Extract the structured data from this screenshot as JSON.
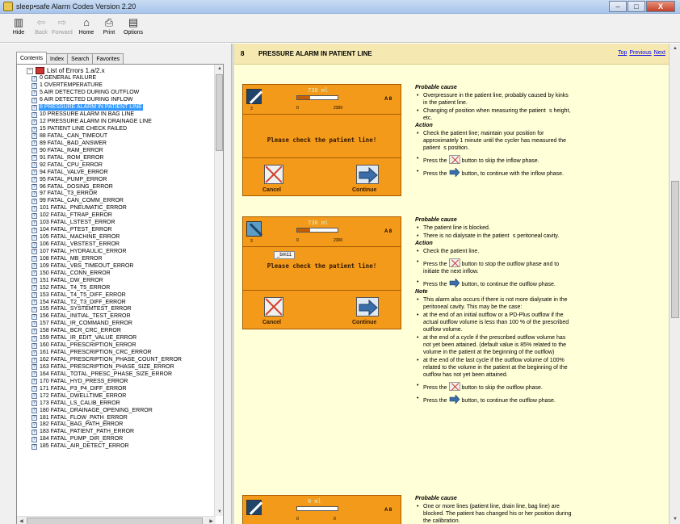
{
  "window": {
    "title": "sleep•safe Alarm Codes Version 2.20",
    "controls": [
      "–",
      "□",
      "X"
    ]
  },
  "toolbar": [
    {
      "name": "hide",
      "label": "Hide",
      "icon": "hide-icon",
      "glyph": "▥",
      "enabled": true
    },
    {
      "name": "back",
      "label": "Back",
      "icon": "back-arrow-icon",
      "glyph": "⇦",
      "enabled": false
    },
    {
      "name": "forward",
      "label": "Forward",
      "icon": "forward-arrow-icon",
      "glyph": "⇨",
      "enabled": false
    },
    {
      "name": "home",
      "label": "Home",
      "icon": "home-icon",
      "glyph": "⌂",
      "enabled": true
    },
    {
      "name": "print",
      "label": "Print",
      "icon": "printer-icon",
      "glyph": "⎙",
      "enabled": true
    },
    {
      "name": "options",
      "label": "Options",
      "icon": "options-icon",
      "glyph": "▤",
      "enabled": true
    }
  ],
  "nav": {
    "tabs": [
      "Contents",
      "Index",
      "Search",
      "Favorites"
    ],
    "active_tab": "Contents",
    "root": "List of Errors 1.a/2.x",
    "items": [
      "0 GENERAL FAILURE",
      "1 OVERTEMPERATURE",
      "5 AIR DETECTED DURING OUTFLOW",
      "6 AIR DETECTED DURING INFLOW",
      "8 PRESSURE ALARM IN PATIENT LINE",
      "10 PRESSURE ALARM IN BAG LINE",
      "12 PRESSURE ALARM IN DRAINAGE LINE",
      "15 PATIENT LINE CHECK FAILED",
      "88 FATAL_CAN_TIMEOUT",
      "89 FATAL_BAD_ANSWER",
      "90 FATAL_RAM_ERROR",
      "91 FATAL_ROM_ERROR",
      "92 FATAL_CPU_ERROR",
      "94 FATAL_VALVE_ERROR",
      "95 FATAL_PUMP_ERROR",
      "96 FATAL_DOSING_ERROR",
      "97 FATAL_T3_ERROR",
      "99 FATAL_CAN_COMM_ERROR",
      "101 FATAL_PNEUMATIC_ERROR",
      "102 FATAL_FTRAP_ERROR",
      "103 FATAL_LSTEST_ERROR",
      "104 FATAL_PTEST_ERROR",
      "105 FATAL_MACHINE_ERROR",
      "106 FATAL_VBSTEST_ERROR",
      "107 FATAL_HYDRAULIC_ERROR",
      "108 FATAL_MB_ERROR",
      "109 FATAL_VBS_TIMEOUT_ERROR",
      "150 FATAL_CONN_ERROR",
      "151 FATAL_DW_ERROR",
      "152 FATAL_T4_T5_ERROR",
      "153 FATAL_T4_T5_DIFF_ERROR",
      "154 FATAL_T2_T3_DIFF_ERROR",
      "155 FATAL_SYSTEMTEST_ERROR",
      "156 FATAL_INITIAL_TEST_ERROR",
      "157 FATAL_IR_COMMAND_ERROR",
      "158 FATAL_BCR_CRC_ERROR",
      "159 FATAL_IR_EDIT_VALUE_ERROR",
      "160 FATAL_PRESCRIPTION_ERROR",
      "161 FATAL_PRESCRIPTION_CRC_ERROR",
      "162 FATAL_PRESCRIPTION_PHASE_COUNT_ERROR",
      "163 FATAL_PRESCRIPTION_PHASE_SIZE_ERROR",
      "164 FATAL_TOTAL_PRESC_PHASE_SIZE_ERROR",
      "170 FATAL_HYD_PRESS_ERROR",
      "171 FATAL_P3_P4_DIFF_ERROR",
      "172 FATAL_DWELLTIME_ERROR",
      "173 FATAL_LS_CALIB_ERROR",
      "180 FATAL_DRAINAGE_OPENING_ERROR",
      "181 FATAL_FLOW_PATH_ERROR",
      "182 FATAL_BAG_PATH_ERROR",
      "183 FATAL_PATIENT_PATH_ERROR",
      "184 FATAL_PUMP_DIR_ERROR",
      "185 FATAL_AIR_DETECT_ERROR"
    ],
    "selected_index": 4
  },
  "content": {
    "number": "8",
    "title": "PRESSURE ALARM IN PATIENT LINE",
    "links": [
      "Top",
      "Previous",
      "Next"
    ],
    "screens": [
      {
        "volume": "730 ml",
        "bar_fill": 0.32,
        "scale_min": "0",
        "scale_max": "2300",
        "icon_num": "3",
        "ab": "A 8",
        "message": "Please check the patient line!",
        "tooltip": "",
        "cancel": "Cancel",
        "continue": "Continue"
      },
      {
        "volume": "730 ml",
        "bar_fill": 0.32,
        "scale_min": "0",
        "scale_max": "2300",
        "icon_num": "3",
        "ab": "A 8",
        "message": "Please check the patient line!",
        "tooltip": "_bm11",
        "cancel": "Cancel",
        "continue": "Continue"
      },
      {
        "volume": "0 ml",
        "bar_fill": 0.0,
        "scale_min": "0",
        "scale_max": "0",
        "icon_num": "",
        "ab": "A 8",
        "message": "",
        "tooltip": "",
        "cancel": "",
        "continue": ""
      }
    ],
    "block1": {
      "probable_cause_title": "Probable cause",
      "causes": [
        "Overpressure in the patient line, probably caused by kinks in the patient line.",
        "Changing of position when measuring the patients height, etc."
      ],
      "action_title": "Action",
      "action_text": "Check the patient line; maintain your position for approximately 1 minute until the cycler has measured the patients position.",
      "press_cancel_pre": "Press the",
      "press_cancel_post": "button to skip the inflow phase.",
      "press_continue_pre": "Press the",
      "press_continue_post": "button, to continue with the inflow phase."
    },
    "block2": {
      "probable_cause_title": "Probable cause",
      "causes": [
        "The patient line is blocked.",
        "There is no dialysate in the patients peritoneal cavity."
      ],
      "action_title": "Action",
      "action_check": "Check the patient line.",
      "press_cancel_pre": "Press the",
      "press_cancel_post": "button to stop the outflow phase and to initiate the next inflow.",
      "press_continue_pre": "Press the",
      "press_continue_post": "button, to continue the outflow phase.",
      "note_title": "Note",
      "note_intro": "This alarm also occurs if there is not more dialysate in the peritoneal cavity. This may be the case:",
      "note_items": [
        "at the end of an initial outflow or a PD-Plus outflow if the actual outflow volume is less than 100 % of the prescribed outflow volume.",
        "at the end of a cycle if the prescribed outflow volume has not yet been attained. (default value is 85% related to the volume in the patient at the beginning of the outflow)",
        "at the end of the last cycle if the outflow volume of 100% related to the volume in the patient at the beginning of the outflow has not yet been attained."
      ],
      "press2_cancel_pre": "Press the",
      "press2_cancel_post": "button to skip the outflow phase.",
      "press2_continue_pre": "Press the",
      "press2_continue_post": "button, to continue the outflow phase."
    },
    "block3": {
      "probable_cause_title": "Probable cause",
      "causes": [
        "One or more lines (patient line, drain line, bag line) are blocked. The patient has changed his or her position during the calibration."
      ]
    }
  }
}
